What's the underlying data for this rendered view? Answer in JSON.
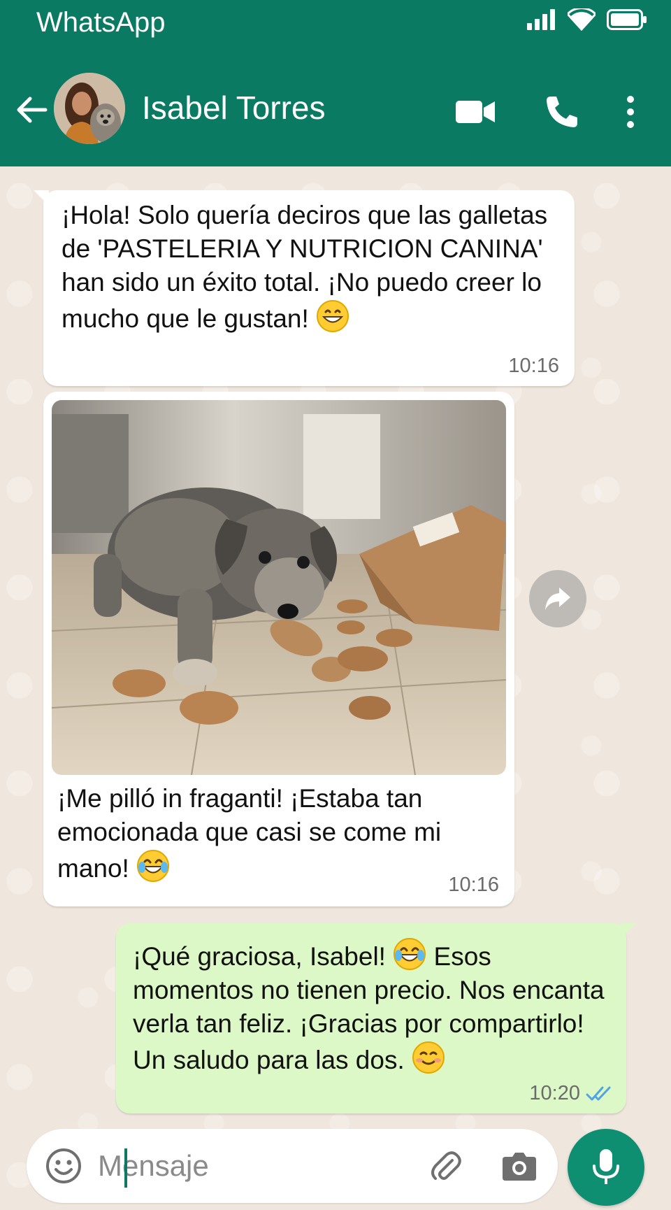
{
  "status_bar": {
    "app_name": "WhatsApp"
  },
  "header": {
    "contact_name": "Isabel Torres"
  },
  "messages": [
    {
      "direction": "incoming",
      "text": "¡Hola! Solo quería deciros que las galletas de 'PASTELERIA Y NUTRICION CANINA' han sido un éxito total. ¡No puedo creer lo mucho que le gustan!",
      "emoji": "grinning-face",
      "time": "10:16"
    },
    {
      "direction": "incoming",
      "image": "dog-eating-cookies-photo",
      "text": "¡Me pilló in fraganti! ¡Estaba tan emocionada que casi se come mi mano!",
      "emoji": "tears-of-joy",
      "time": "10:16"
    },
    {
      "direction": "outgoing",
      "text_before_emoji": "¡Qué graciosa, Isabel!",
      "emoji": "tears-of-joy",
      "text_after_emoji": "Esos momentos no tienen precio. Nos encanta verla tan feliz. ¡Gracias por compartirlo! Un saludo para las dos.",
      "emoji_end": "smiling-face",
      "time": "10:20",
      "receipt": "read-double-check"
    }
  ],
  "composer": {
    "placeholder": "Mensaje"
  },
  "colors": {
    "header": "#0b7a63",
    "chat_bg": "#efe7de",
    "incoming_bubble": "#ffffff",
    "outgoing_bubble": "#dcf8c6",
    "read_ticks": "#4fa3e6",
    "mic_button": "#0f8f72"
  }
}
